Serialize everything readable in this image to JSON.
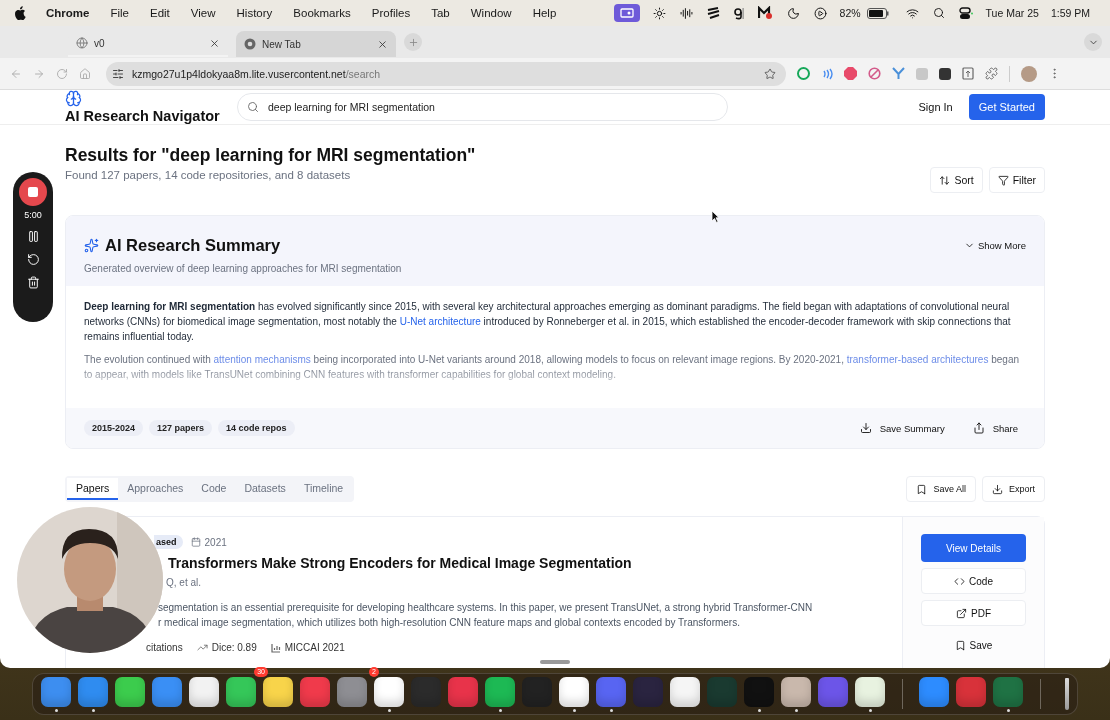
{
  "menu_bar": {
    "app": "Chrome",
    "menus": [
      "File",
      "Edit",
      "View",
      "History",
      "Bookmarks",
      "Profiles",
      "Tab",
      "Window",
      "Help"
    ],
    "battery": "82%",
    "date": "Tue Mar 25",
    "time": "1:59 PM"
  },
  "browser": {
    "tabs": [
      {
        "title": "v0",
        "selected": true
      },
      {
        "title": "New Tab",
        "selected": false
      }
    ],
    "url": {
      "host": "kzmgo27u1p4ldokyaa8m.lite.vusercontent.net",
      "path": "/search"
    }
  },
  "header": {
    "brand": "AI Research Navigator",
    "search_value": "deep learning for MRI segmentation",
    "sign_in": "Sign In",
    "get_started": "Get Started"
  },
  "results": {
    "title": "Results for \"deep learning for MRI segmentation\"",
    "subtitle": "Found 127 papers, 14 code repositories, and 8 datasets",
    "sort": "Sort",
    "filter": "Filter"
  },
  "summary": {
    "title": "AI Research Summary",
    "subtitle": "Generated overview of deep learning approaches for MRI segmentation",
    "toggle": "Show More",
    "paragraphs": [
      {
        "faded": false,
        "segments": [
          {
            "kind": "bold",
            "text": "Deep learning for MRI segmentation"
          },
          {
            "kind": "text",
            "text": " has evolved significantly since 2015, with several key architectural approaches emerging as dominant paradigms. The field began with adaptations of convolutional neural networks (CNNs) for biomedical image segmentation, most notably the "
          },
          {
            "kind": "link",
            "text": "U-Net architecture"
          },
          {
            "kind": "text",
            "text": " introduced by Ronneberger et al. in 2015, which established the encoder-decoder framework with skip connections that remains influential today."
          }
        ]
      },
      {
        "faded": true,
        "segments": [
          {
            "kind": "text",
            "text": "The evolution continued with "
          },
          {
            "kind": "link",
            "text": "attention mechanisms"
          },
          {
            "kind": "text",
            "text": " being incorporated into U-Net variants around 2018, allowing models to focus on relevant image regions. By 2020-2021, "
          },
          {
            "kind": "link",
            "text": "transformer-based architectures"
          },
          {
            "kind": "text",
            "text": " began to appear, with models like TransUNet combining CNN features with transformer capabilities for global context modeling."
          }
        ]
      }
    ],
    "chips": [
      "2015-2024",
      "127 papers",
      "14 code repos"
    ],
    "save": "Save Summary",
    "share": "Share"
  },
  "content_tabs": [
    {
      "label": "Papers",
      "selected": true
    },
    {
      "label": "Approaches",
      "selected": false
    },
    {
      "label": "Code",
      "selected": false
    },
    {
      "label": "Datasets",
      "selected": false
    },
    {
      "label": "Timeline",
      "selected": false
    }
  ],
  "list_actions": {
    "save_all": "Save All",
    "export": "Export"
  },
  "paper": {
    "badge": "ased",
    "year": "2021",
    "title": "Transformers Make Strong Encoders for Medical Image Segmentation",
    "authors": "Q, et al.",
    "abstract_lines": [
      "segmentation is an essential prerequisite for developing healthcare systems. In this paper, we present TransUNet, a strong hybrid Transformer-CNN",
      "r medical image segmentation, which utilizes both high-resolution CNN feature maps and global contexts encoded by Transformers."
    ],
    "citations": "citations",
    "dice": "Dice: 0.89",
    "venue": "MICCAI 2021",
    "view_details": "View Details",
    "code": "Code",
    "pdf": "PDF",
    "save": "Save"
  },
  "recorder": {
    "time": "5:00"
  },
  "dock": {
    "apps": [
      {
        "color": "#3d8ef0",
        "running": true
      },
      {
        "color": "#2f8cf0",
        "running": true
      },
      {
        "color": "#3ccc4d",
        "running": false
      },
      {
        "color": "#3a8ff5",
        "running": false
      },
      {
        "color": "#f2f2f2",
        "running": false
      },
      {
        "color": "#35c759",
        "running": false,
        "badge": "30"
      },
      {
        "color": "#f8d44a",
        "running": false
      },
      {
        "color": "#f03a4b",
        "running": false
      },
      {
        "color": "#8e8e93",
        "running": false,
        "badge": "2"
      },
      {
        "color": "#ffffff",
        "running": true
      },
      {
        "color": "#2b2b2b",
        "running": false
      },
      {
        "color": "#e8334a",
        "running": false
      },
      {
        "color": "#1db954",
        "running": true
      },
      {
        "color": "#222222",
        "running": false
      },
      {
        "color": "#ffffff",
        "running": true
      },
      {
        "color": "#5865f2",
        "running": true
      },
      {
        "color": "#2a2440",
        "running": false
      },
      {
        "color": "#f5f5f5",
        "running": false
      },
      {
        "color": "#1a3a30",
        "running": false
      },
      {
        "color": "#111111",
        "running": true
      },
      {
        "color": "#c9b8ac",
        "running": true
      },
      {
        "color": "#6c55e8",
        "running": false
      },
      {
        "color": "#e8f2e0",
        "running": true
      },
      {
        "color": "#2d8cff",
        "running": false
      },
      {
        "color": "#d8323a",
        "running": false
      },
      {
        "color": "#1f7244",
        "running": true
      }
    ]
  }
}
